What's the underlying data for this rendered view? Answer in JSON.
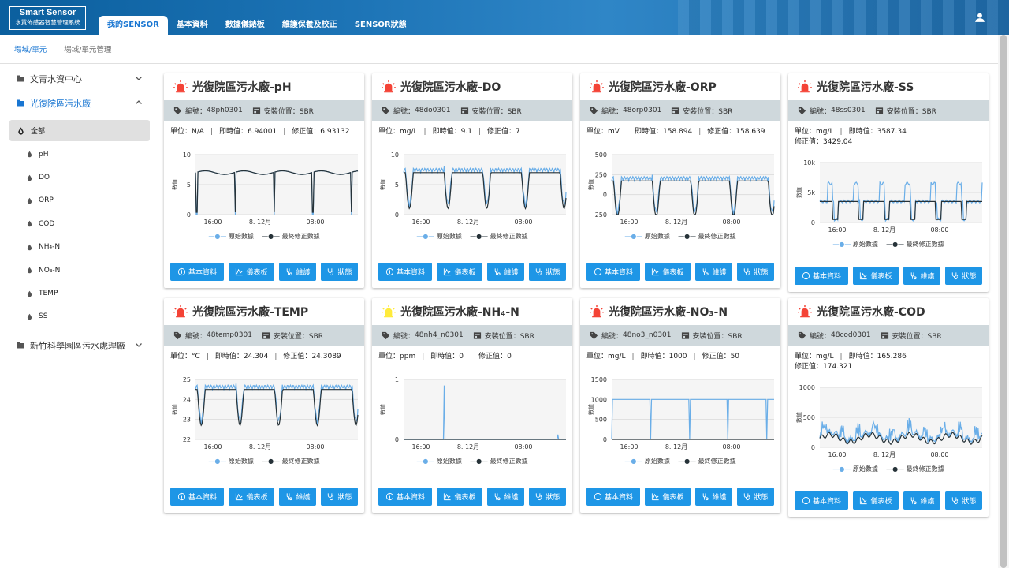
{
  "app": {
    "logo_title": "Smart Sensor",
    "logo_subtitle": "水質佈感器智慧管理系統"
  },
  "nav": {
    "tabs": [
      "我的SENSOR",
      "基本資料",
      "數據儀錶板",
      "維護保養及校正",
      "SENSOR狀態"
    ],
    "active": 0
  },
  "breadcrumb": {
    "active": "場域/單元",
    "inactive": "場域/單元管理"
  },
  "sidebar": {
    "groups": [
      {
        "label": "文青水資中心",
        "expanded": false
      },
      {
        "label": "光復院區污水廠",
        "expanded": true
      },
      {
        "label": "新竹科學園區污水處理廠",
        "expanded": false
      }
    ],
    "items": [
      "全部",
      "pH",
      "DO",
      "ORP",
      "COD",
      "NH₄-N",
      "NO₃-N",
      "TEMP",
      "SS"
    ]
  },
  "colors": {
    "accent": "#1976d2",
    "button": "#1e96e6",
    "raw": "#6aaee8",
    "final": "#263238",
    "alarm_red": "#f44336",
    "alarm_yellow": "#ffeb3b"
  },
  "common": {
    "tag_prefix": "編號：",
    "location": "安裝位置：SBR",
    "unit_label": "單位：",
    "realtime_label": "即時值：",
    "corrected_label": "修正值：",
    "y_axis_label": "數值",
    "x_ticks": [
      "16:00",
      "8. 12月",
      "08:00"
    ],
    "legend": [
      "原始數據",
      "最終修正數據"
    ],
    "buttons": [
      "基本資料",
      "儀表板",
      "維護",
      "狀態"
    ]
  },
  "cards": [
    {
      "title": "光復院區污水廠-pH",
      "alarm": "red",
      "tag": "48ph0301",
      "unit": "N/A",
      "realtime": "6.94001",
      "corrected": "6.93132"
    },
    {
      "title": "光復院區污水廠-DO",
      "alarm": "red",
      "tag": "48do0301",
      "unit": "mg/L",
      "realtime": "9.1",
      "corrected": "7"
    },
    {
      "title": "光復院區污水廠-ORP",
      "alarm": "red",
      "tag": "48orp0301",
      "unit": "mV",
      "realtime": "158.894",
      "corrected": "158.639"
    },
    {
      "title": "光復院區污水廠-SS",
      "alarm": "red",
      "tag": "48ss0301",
      "unit": "mg/L",
      "realtime": "3587.34",
      "corrected": "3429.04"
    },
    {
      "title": "光復院區污水廠-TEMP",
      "alarm": "red",
      "tag": "48temp0301",
      "unit": "°C",
      "realtime": "24.304",
      "corrected": "24.3089"
    },
    {
      "title": "光復院區污水廠-NH₄-N",
      "alarm": "yellow",
      "tag": "48nh4_n0301",
      "unit": "ppm",
      "realtime": "0",
      "corrected": "0"
    },
    {
      "title": "光復院區污水廠-NO₃-N",
      "alarm": "red",
      "tag": "48no3_n0301",
      "unit": "mg/L",
      "realtime": "1000",
      "corrected": "50"
    },
    {
      "title": "光復院區污水廠-COD",
      "alarm": "red",
      "tag": "48cod0301",
      "unit": "mg/L",
      "realtime": "165.286",
      "corrected": "174.321"
    }
  ],
  "chart_data": [
    {
      "type": "line",
      "ylabel": "數值",
      "yticks": [
        "10",
        "5",
        "0"
      ],
      "ylim": [
        0,
        10
      ],
      "series": [
        {
          "name": "原始數據"
        },
        {
          "name": "最終修正數據"
        }
      ],
      "raw_pattern": "spikes",
      "final_level": 7
    },
    {
      "type": "line",
      "ylabel": "數值",
      "yticks": [
        "10",
        "5",
        "0"
      ],
      "ylim": [
        0,
        10
      ],
      "series": [
        {
          "name": "原始數據"
        },
        {
          "name": "最終修正數據"
        }
      ],
      "raw_pattern": "dips",
      "final_level": 7
    },
    {
      "type": "line",
      "ylabel": "數值",
      "yticks": [
        "500",
        "250",
        "0",
        "−250"
      ],
      "ylim": [
        -300,
        500
      ],
      "series": [
        {
          "name": "原始數據"
        },
        {
          "name": "最終修正數據"
        }
      ],
      "raw_pattern": "dips",
      "final_level": 150
    },
    {
      "type": "line",
      "ylabel": "數值",
      "yticks": [
        "10k",
        "5k",
        "0"
      ],
      "ylim": [
        0,
        10000
      ],
      "series": [
        {
          "name": "原始數據"
        },
        {
          "name": "最終修正數據"
        }
      ],
      "raw_pattern": "square",
      "final_level": 3500
    },
    {
      "type": "line",
      "ylabel": "數值",
      "yticks": [
        "25",
        "24",
        "23",
        "22"
      ],
      "ylim": [
        22,
        25
      ],
      "series": [
        {
          "name": "原始數據"
        },
        {
          "name": "最終修正數據"
        }
      ],
      "raw_pattern": "dips",
      "final_level": 24.5
    },
    {
      "type": "line",
      "ylabel": "數值",
      "yticks": [
        "1",
        "0"
      ],
      "ylim": [
        0,
        1
      ],
      "series": [
        {
          "name": "原始數據"
        },
        {
          "name": "最終修正數據"
        }
      ],
      "raw_pattern": "single-spike",
      "final_level": 0
    },
    {
      "type": "line",
      "ylabel": "數值",
      "yticks": [
        "1500",
        "1000",
        "500",
        "0"
      ],
      "ylim": [
        0,
        1500
      ],
      "series": [
        {
          "name": "原始數據"
        },
        {
          "name": "最終修正數據"
        }
      ],
      "raw_pattern": "drops",
      "final_level": 0
    },
    {
      "type": "line",
      "ylabel": "數值",
      "yticks": [
        "1000",
        "500",
        "0"
      ],
      "ylim": [
        0,
        1000
      ],
      "series": [
        {
          "name": "原始數據"
        },
        {
          "name": "最終修正數據"
        }
      ],
      "raw_pattern": "noisy",
      "final_level": 150
    }
  ]
}
